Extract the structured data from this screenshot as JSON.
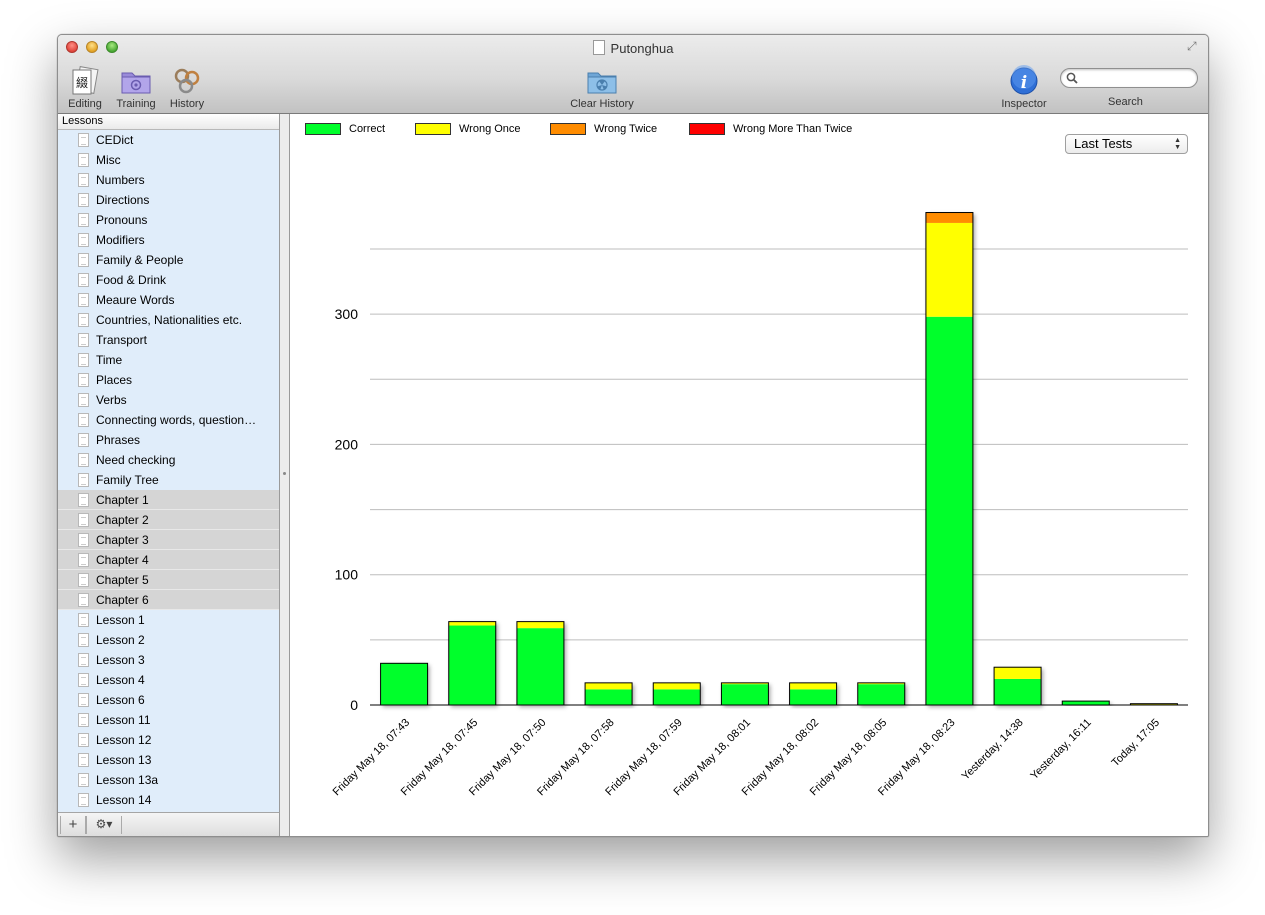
{
  "window": {
    "title": "Putonghua"
  },
  "toolbar": {
    "editing_label": "Editing",
    "training_label": "Training",
    "history_label": "History",
    "clear_history_label": "Clear History",
    "inspector_label": "Inspector",
    "search_label": "Search",
    "search_placeholder": ""
  },
  "sidebar": {
    "header": "Lessons",
    "items": [
      {
        "label": "CEDict",
        "selected": false
      },
      {
        "label": "Misc",
        "selected": false
      },
      {
        "label": "Numbers",
        "selected": false
      },
      {
        "label": "Directions",
        "selected": false
      },
      {
        "label": "Pronouns",
        "selected": false
      },
      {
        "label": "Modifiers",
        "selected": false
      },
      {
        "label": "Family & People",
        "selected": false
      },
      {
        "label": "Food & Drink",
        "selected": false
      },
      {
        "label": "Meaure Words",
        "selected": false
      },
      {
        "label": "Countries, Nationalities etc.",
        "selected": false
      },
      {
        "label": "Transport",
        "selected": false
      },
      {
        "label": "Time",
        "selected": false
      },
      {
        "label": "Places",
        "selected": false
      },
      {
        "label": "Verbs",
        "selected": false
      },
      {
        "label": "Connecting words, question…",
        "selected": false
      },
      {
        "label": "Phrases",
        "selected": false
      },
      {
        "label": "Need checking",
        "selected": false
      },
      {
        "label": "Family Tree",
        "selected": false
      },
      {
        "label": "Chapter 1",
        "selected": true
      },
      {
        "label": "Chapter 2",
        "selected": true
      },
      {
        "label": "Chapter 3",
        "selected": true
      },
      {
        "label": "Chapter 4",
        "selected": true
      },
      {
        "label": "Chapter 5",
        "selected": true
      },
      {
        "label": "Chapter 6",
        "selected": true
      },
      {
        "label": "Lesson 1",
        "selected": false
      },
      {
        "label": "Lesson 2",
        "selected": false
      },
      {
        "label": "Lesson 3",
        "selected": false
      },
      {
        "label": "Lesson 4",
        "selected": false
      },
      {
        "label": "Lesson 6",
        "selected": false
      },
      {
        "label": "Lesson 11",
        "selected": false
      },
      {
        "label": "Lesson 12",
        "selected": false
      },
      {
        "label": "Lesson 13",
        "selected": false
      },
      {
        "label": "Lesson 13a",
        "selected": false
      },
      {
        "label": "Lesson 14",
        "selected": false
      }
    ],
    "add_button": "+",
    "action_button": "⚙▾"
  },
  "history_view": {
    "range_select": "Last Tests",
    "legend": [
      {
        "label": "Correct",
        "color": "#00ff2b"
      },
      {
        "label": "Wrong Once",
        "color": "#ffff00"
      },
      {
        "label": "Wrong Twice",
        "color": "#ff8c00"
      },
      {
        "label": "Wrong More Than Twice",
        "color": "#ff0000"
      }
    ]
  },
  "chart_data": {
    "type": "bar",
    "stacked": true,
    "categories": [
      "Friday May 18, 07:43",
      "Friday May 18, 07:45",
      "Friday May 18, 07:50",
      "Friday May 18, 07:58",
      "Friday May 18, 07:59",
      "Friday May 18, 08:01",
      "Friday May 18, 08:02",
      "Friday May 18, 08:05",
      "Friday May 18, 08:23",
      "Yesterday, 14:38",
      "Yesterday, 16:11",
      "Today, 17:05"
    ],
    "series": [
      {
        "name": "Correct",
        "color": "#00ff2b",
        "values": [
          32,
          61,
          59,
          12,
          12,
          16,
          12,
          16,
          298,
          20,
          3,
          0
        ]
      },
      {
        "name": "Wrong Once",
        "color": "#ffff00",
        "values": [
          0,
          3,
          5,
          5,
          5,
          1,
          5,
          1,
          72,
          9,
          0,
          1
        ]
      },
      {
        "name": "Wrong Twice",
        "color": "#ff8c00",
        "values": [
          0,
          0,
          0,
          0,
          0,
          0,
          0,
          0,
          8,
          0,
          0,
          0
        ]
      },
      {
        "name": "Wrong More Than Twice",
        "color": "#ff0000",
        "values": [
          0,
          0,
          0,
          0,
          0,
          0,
          0,
          0,
          0,
          0,
          0,
          0
        ]
      }
    ],
    "ylim": [
      0,
      350
    ],
    "yticks": [
      0,
      100,
      200,
      300
    ],
    "gridlines": [
      0,
      50,
      100,
      150,
      200,
      250,
      300,
      350
    ],
    "grid": true,
    "legend_position": "top-left"
  }
}
